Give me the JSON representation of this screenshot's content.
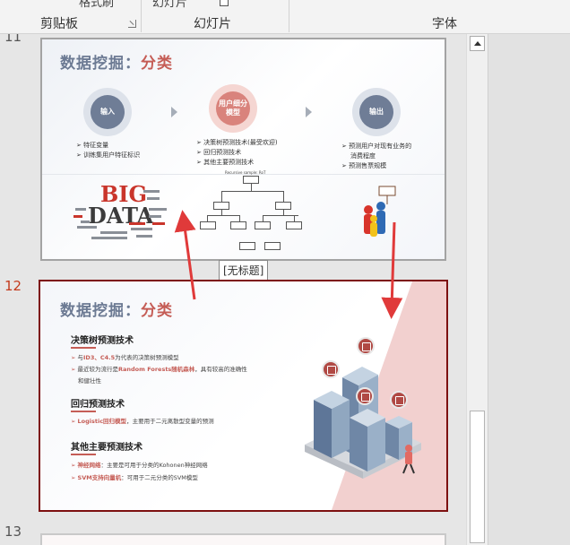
{
  "ribbon": {
    "partial_top_left": "格式刷",
    "partial_top_mid": "幻灯片",
    "group_clipboard": "剪贴板",
    "group_slides": "幻灯片",
    "group_font": "字体"
  },
  "slides": [
    {
      "number": "11",
      "title_main": "数据挖掘：",
      "title_highlight": "分类",
      "steps": [
        {
          "label": "输入",
          "bullets": [
            "特征变量",
            "训练集用户特征标识"
          ]
        },
        {
          "label": "用户细分模型",
          "bullets": [
            "决策树预测技术(最受欢迎)",
            "回归预测技术",
            "其他主要预测技术"
          ]
        },
        {
          "label": "输出",
          "bullets": [
            "预测用户对现有业务的",
            "消费程度",
            "预测售票规模"
          ]
        }
      ],
      "big_word": "BIG",
      "data_word": "DATA",
      "tree_caption": "Recursive sample: RoT"
    },
    {
      "number": "12",
      "title_main": "数据挖掘：",
      "title_highlight": "分类",
      "sections": [
        {
          "heading": "决策树预测技术",
          "lines": [
            {
              "pre": "与",
              "red": "ID3、C4.5",
              "post": "为代表的决策树预测模型"
            },
            {
              "pre": "最近较为流行是",
              "red": "Random Forests随机森林",
              "post": "，具有较高的准确性"
            },
            {
              "pre": "",
              "red": "",
              "post": "和健壮性"
            }
          ]
        },
        {
          "heading": "回归预测技术",
          "lines": [
            {
              "pre": "",
              "red": "Logistic回归模型",
              "post": "，主要用于二元离散型变量的预测"
            }
          ]
        },
        {
          "heading": "其他主要预测技术",
          "lines": [
            {
              "pre": "",
              "red": "神经网络",
              "post": "：主要是可用于分类的Kohonen神经网络"
            },
            {
              "pre": "",
              "red": "SVM支持向量机",
              "post": "：可用于二元分类的SVM模型"
            }
          ]
        }
      ]
    },
    {
      "number": "13"
    }
  ],
  "tooltip": "[无标题]",
  "colors": {
    "accent": "#c43b1d",
    "arrow": "#e03a3a",
    "title": "#6c7a93",
    "highlight": "#c55d56"
  }
}
